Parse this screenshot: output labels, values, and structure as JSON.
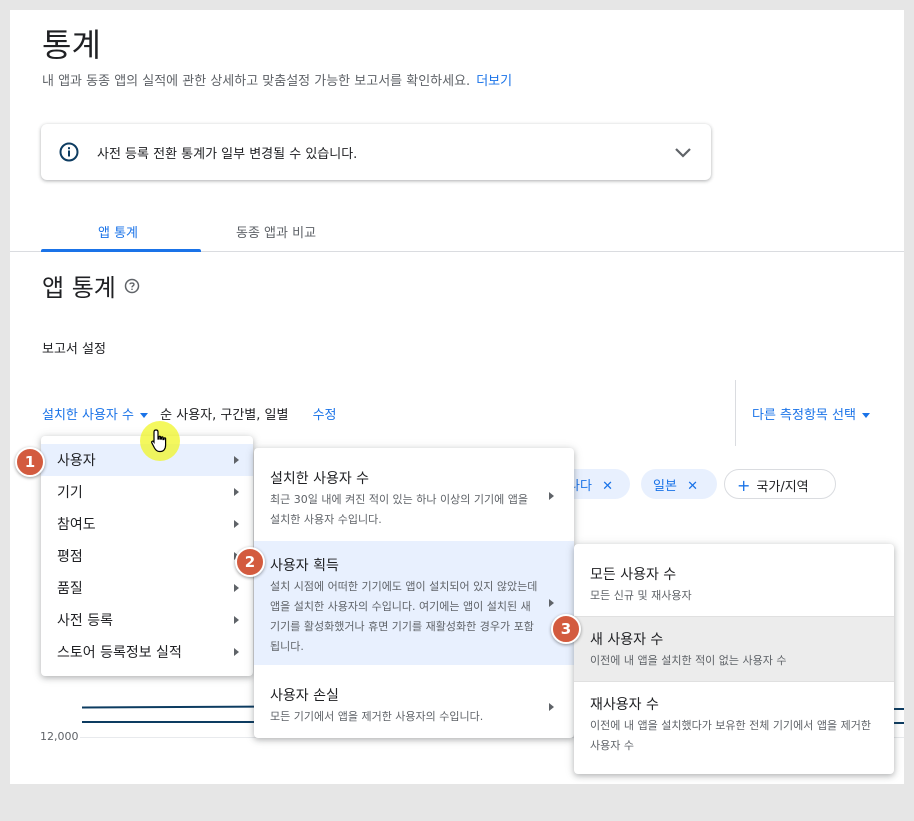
{
  "header": {
    "title": "통계",
    "subtitle": "내 앱과 동종 앱의 실적에 관한 상세하고 맞춤설정 가능한 보고서를 확인하세요.",
    "more_link": "더보기"
  },
  "notice": {
    "text": "사전 등록 전환 통계가 일부 변경될 수 있습니다.",
    "icon": "info-icon",
    "expand_icon": "chevron-down-icon"
  },
  "tabs": [
    {
      "label": "앱 통계",
      "active": true
    },
    {
      "label": "동종 앱과 비교",
      "active": false
    }
  ],
  "section": {
    "title": "앱 통계",
    "report_settings_label": "보고서 설정"
  },
  "controls": {
    "metric_dropdown": "설치한 사용자 수",
    "metric_detail": "순 사용자, 구간별, 일별",
    "edit_link": "수정",
    "other_metric": "다른 측정항목 선택"
  },
  "chips": [
    {
      "label": "나다"
    },
    {
      "label": "일본"
    },
    {
      "label": "국가/지역"
    }
  ],
  "chart": {
    "y_label": "12,000"
  },
  "menu_level1": {
    "items": [
      {
        "label": "사용자",
        "highlighted": true
      },
      {
        "label": "기기"
      },
      {
        "label": "참여도"
      },
      {
        "label": "평점"
      },
      {
        "label": "품질"
      },
      {
        "label": "사전 등록"
      },
      {
        "label": "스토어 등록정보 실적"
      }
    ]
  },
  "menu_level2": {
    "items": [
      {
        "title": "설치한 사용자 수",
        "desc": "최근 30일 내에 켜진 적이 있는 하나 이상의 기기에 앱을 설치한 사용자 수입니다."
      },
      {
        "title": "사용자 획득",
        "desc": "설치 시점에 어떠한 기기에도 앱이 설치되어 있지 않았는데 앱을 설치한 사용자의 수입니다. 여기에는 앱이 설치된 새 기기를 활성화했거나 휴면 기기를 재활성화한 경우가 포함됩니다.",
        "highlighted": true
      },
      {
        "title": "사용자 손실",
        "desc": "모든 기기에서 앱을 제거한 사용자의 수입니다."
      }
    ]
  },
  "menu_level3": {
    "items": [
      {
        "title": "모든 사용자 수",
        "desc": "모든 신규 및 재사용자"
      },
      {
        "title": "새 사용자 수",
        "desc": "이전에 내 앱을 설치한 적이 없는 사용자 수",
        "highlighted": true
      },
      {
        "title": "재사용자 수",
        "desc": "이전에 내 앱을 설치했다가 보유한 전체 기기에서 앱을 제거한 사용자 수"
      }
    ]
  },
  "steps": [
    "1",
    "2",
    "3"
  ]
}
